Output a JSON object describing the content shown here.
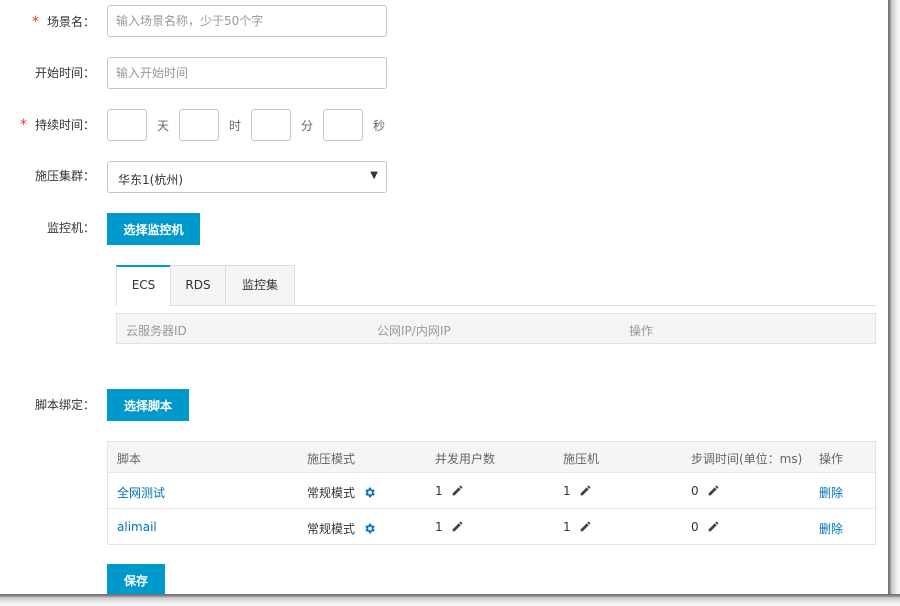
{
  "form": {
    "scene_name": {
      "label": "场景名：",
      "placeholder": "输入场景名称，少于50个字",
      "value": ""
    },
    "start_time": {
      "label": "开始时间：",
      "placeholder": "输入开始时间",
      "value": ""
    },
    "duration": {
      "label": "持续时间：",
      "units": {
        "day": "天",
        "hour": "时",
        "minute": "分",
        "second": "秒"
      }
    },
    "cluster": {
      "label": "施压集群：",
      "selected": "华东1(杭州)"
    },
    "monitor": {
      "label": "监控机：",
      "button": "选择监控机"
    },
    "script": {
      "label": "脚本绑定：",
      "button": "选择脚本"
    },
    "required_mark": "*",
    "save_button": "保存"
  },
  "monitor_tabs": [
    "ECS",
    "RDS",
    "监控集"
  ],
  "ecs_table": {
    "columns": [
      "云服务器ID",
      "公网IP/内网IP",
      "操作"
    ]
  },
  "script_table": {
    "columns": [
      "脚本",
      "施压模式",
      "并发用户数",
      "施压机",
      "步调时间(单位：ms)",
      "操作"
    ],
    "rows": [
      {
        "name": "全网测试",
        "mode": "常规模式",
        "users": "1",
        "machines": "1",
        "pacing": "0",
        "action": "删除"
      },
      {
        "name": "alimail",
        "mode": "常规模式",
        "users": "1",
        "machines": "1",
        "pacing": "0",
        "action": "删除"
      }
    ]
  },
  "colors": {
    "primary": "#0099cc",
    "required": "#e4393c",
    "link": "#0073bb"
  },
  "icons": {
    "mode_settings": "gear-icon",
    "edit": "pencil-icon",
    "dropdown": "caret-down-icon"
  }
}
